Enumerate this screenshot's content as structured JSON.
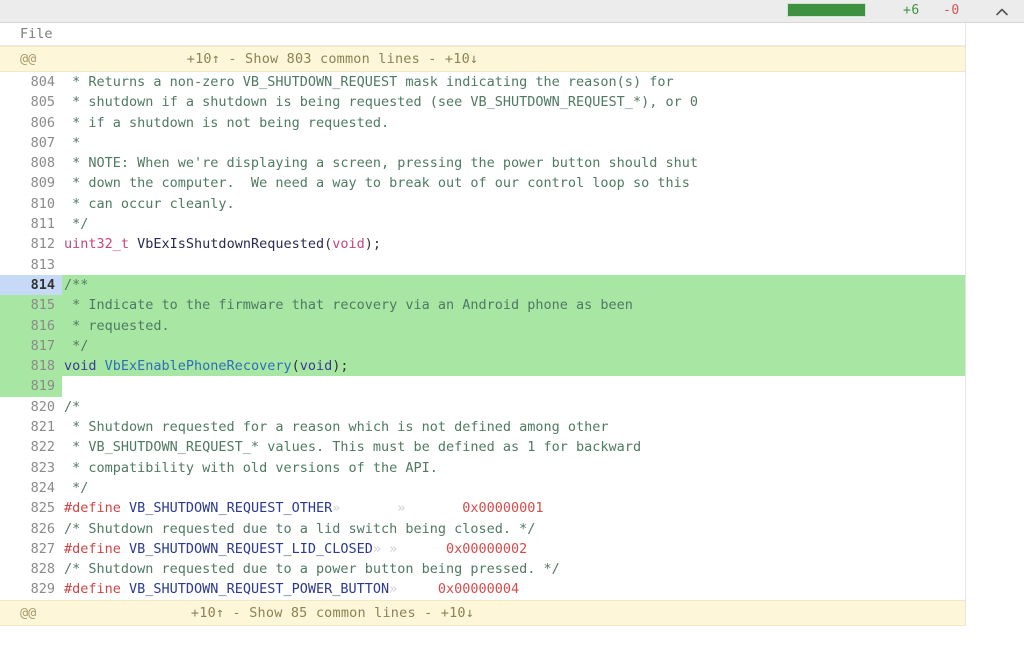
{
  "toolbar": {
    "additions": "+6",
    "deletions": "-0",
    "collapse_icon": "chevron-up-icon",
    "diffstat_color": "#3f9142",
    "additions_color": "#3f9142",
    "deletions_color": "#d9534f"
  },
  "file_row": {
    "label": "File"
  },
  "hunks": {
    "top": {
      "marker": "@@",
      "expand_up": "+10↑",
      "separator": "-",
      "text": "Show 803 common lines",
      "expand_down": "+10↓",
      "full": "+10↑  -  Show 803 common lines  -  +10↓"
    },
    "bottom": {
      "marker": "@@",
      "expand_up": "+10↑",
      "separator": "-",
      "text": "Show 85 common lines",
      "expand_down": "+10↓",
      "full": "+10↑  -  Show 85 common lines  -  +10↓"
    }
  },
  "lines": [
    {
      "num": "804",
      "state": "context",
      "tokens": [
        {
          "t": " * Returns a non-zero VB_SHUTDOWN_REQUEST mask indicating the reason(s) for",
          "c": "tok-cmt"
        }
      ]
    },
    {
      "num": "805",
      "state": "context",
      "tokens": [
        {
          "t": " * shutdown if a shutdown is being requested (see VB_SHUTDOWN_REQUEST_*), or 0",
          "c": "tok-cmt"
        }
      ]
    },
    {
      "num": "806",
      "state": "context",
      "tokens": [
        {
          "t": " * if a shutdown is not being requested.",
          "c": "tok-cmt"
        }
      ]
    },
    {
      "num": "807",
      "state": "context",
      "tokens": [
        {
          "t": " *",
          "c": "tok-cmt"
        }
      ]
    },
    {
      "num": "808",
      "state": "context",
      "tokens": [
        {
          "t": " * NOTE: When we're displaying a screen, pressing the power button should shut",
          "c": "tok-cmt"
        }
      ]
    },
    {
      "num": "809",
      "state": "context",
      "tokens": [
        {
          "t": " * down the computer.  We need a way to break out of our control loop so this",
          "c": "tok-cmt"
        }
      ]
    },
    {
      "num": "810",
      "state": "context",
      "tokens": [
        {
          "t": " * can occur cleanly.",
          "c": "tok-cmt"
        }
      ]
    },
    {
      "num": "811",
      "state": "context",
      "tokens": [
        {
          "t": " */",
          "c": "tok-cmt"
        }
      ]
    },
    {
      "num": "812",
      "state": "context",
      "tokens": [
        {
          "t": "uint32_t",
          "c": "tok-kw"
        },
        {
          "t": " VbExIsShutdownRequested",
          "c": "tok-fn"
        },
        {
          "t": "(",
          "c": "tok-punct"
        },
        {
          "t": "void",
          "c": "tok-kw"
        },
        {
          "t": ");",
          "c": "tok-punct"
        }
      ]
    },
    {
      "num": "813",
      "state": "context",
      "tokens": [
        {
          "t": "",
          "c": "tok-cmt"
        }
      ]
    },
    {
      "num": "814",
      "state": "added",
      "cursor": true,
      "tokens": [
        {
          "t": "/**",
          "c": "tok-cmt"
        }
      ]
    },
    {
      "num": "815",
      "state": "added",
      "tokens": [
        {
          "t": " * Indicate to the firmware that recovery via an Android phone as been",
          "c": "tok-cmt"
        }
      ]
    },
    {
      "num": "816",
      "state": "added",
      "tokens": [
        {
          "t": " * requested.",
          "c": "tok-cmt"
        }
      ]
    },
    {
      "num": "817",
      "state": "added",
      "tokens": [
        {
          "t": " */",
          "c": "tok-cmt"
        }
      ]
    },
    {
      "num": "818",
      "state": "added",
      "tokens": [
        {
          "t": "void",
          "c": "tok-kw2"
        },
        {
          "t": " VbExEnablePhoneRecovery",
          "c": "tok-fnb"
        },
        {
          "t": "(",
          "c": "tok-punct"
        },
        {
          "t": "void",
          "c": "tok-kw2"
        },
        {
          "t": ");",
          "c": "tok-punct"
        }
      ]
    },
    {
      "num": "819",
      "state": "added",
      "tokens": [
        {
          "t": "",
          "c": "tok-cmt"
        }
      ]
    },
    {
      "num": "820",
      "state": "context",
      "tokens": [
        {
          "t": "/*",
          "c": "tok-cmt"
        }
      ]
    },
    {
      "num": "821",
      "state": "context",
      "tokens": [
        {
          "t": " * Shutdown requested for a reason which is not defined among other",
          "c": "tok-cmt"
        }
      ]
    },
    {
      "num": "822",
      "state": "context",
      "tokens": [
        {
          "t": " * VB_SHUTDOWN_REQUEST_* values. This must be defined as 1 for backward",
          "c": "tok-cmt"
        }
      ]
    },
    {
      "num": "823",
      "state": "context",
      "tokens": [
        {
          "t": " * compatibility with old versions of the API.",
          "c": "tok-cmt"
        }
      ]
    },
    {
      "num": "824",
      "state": "context",
      "tokens": [
        {
          "t": " */",
          "c": "tok-cmt"
        }
      ]
    },
    {
      "num": "825",
      "state": "context",
      "tokens": [
        {
          "t": "#define",
          "c": "tok-pre"
        },
        {
          "t": " VB_SHUTDOWN_REQUEST_OTHER",
          "c": "tok-mac"
        },
        {
          "t": "»       »       ",
          "c": "tok-tab"
        },
        {
          "t": "0x00000001",
          "c": "tok-num"
        }
      ]
    },
    {
      "num": "826",
      "state": "context",
      "tokens": [
        {
          "t": "/* Shutdown requested due to a lid switch being closed. */",
          "c": "tok-cmt"
        }
      ]
    },
    {
      "num": "827",
      "state": "context",
      "tokens": [
        {
          "t": "#define",
          "c": "tok-pre"
        },
        {
          "t": " VB_SHUTDOWN_REQUEST_LID_CLOSED",
          "c": "tok-mac"
        },
        {
          "t": "» »      ",
          "c": "tok-tab"
        },
        {
          "t": "0x00000002",
          "c": "tok-num"
        }
      ]
    },
    {
      "num": "828",
      "state": "context",
      "tokens": [
        {
          "t": "/* Shutdown requested due to a power button being pressed. */",
          "c": "tok-cmt"
        }
      ]
    },
    {
      "num": "829",
      "state": "context",
      "tokens": [
        {
          "t": "#define",
          "c": "tok-pre"
        },
        {
          "t": " VB_SHUTDOWN_REQUEST_POWER_BUTTON",
          "c": "tok-mac"
        },
        {
          "t": "»     ",
          "c": "tok-tab"
        },
        {
          "t": "0x00000004",
          "c": "tok-num"
        }
      ]
    }
  ]
}
